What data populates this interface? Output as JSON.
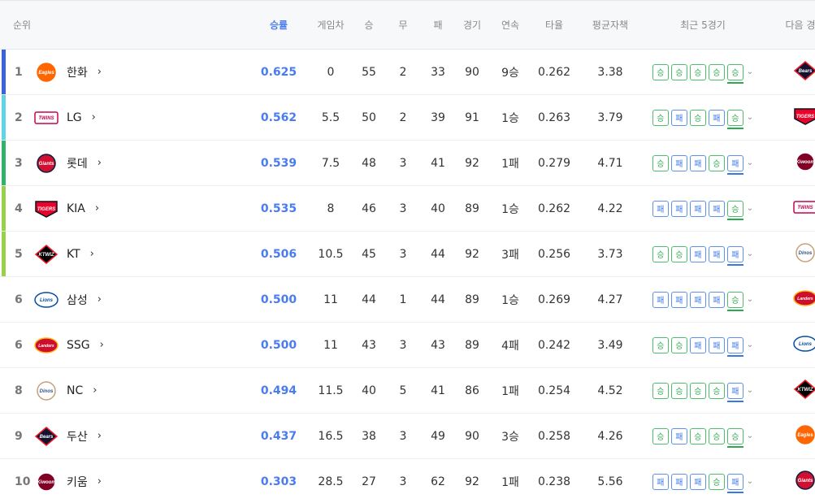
{
  "headers": {
    "rank": "순위",
    "pct": "승률",
    "gb": "게임차",
    "w": "승",
    "d": "무",
    "l": "패",
    "g": "경기",
    "streak": "연속",
    "avg": "타율",
    "era": "평균자책",
    "recent": "최근 5경기",
    "next": "다음 경기"
  },
  "result_labels": {
    "W": "승",
    "L": "패"
  },
  "colors": {
    "accent": "#4a7cf0",
    "win": "#2fa84f",
    "loss": "#3a78e6"
  },
  "teams": [
    {
      "rank": "1",
      "name": "한화",
      "logo": "eagles-logo",
      "bar": "#3b63e0",
      "pct": "0.625",
      "gb": "0",
      "w": "55",
      "d": "2",
      "l": "33",
      "g": "90",
      "streak": "9승",
      "avg": "0.262",
      "era": "3.38",
      "recent": [
        "W",
        "W",
        "W",
        "W",
        "W"
      ],
      "next": "bears-logo"
    },
    {
      "rank": "2",
      "name": "LG",
      "logo": "twins-logo",
      "bar": "#5fd4e6",
      "pct": "0.562",
      "gb": "5.5",
      "w": "50",
      "d": "2",
      "l": "39",
      "g": "91",
      "streak": "1승",
      "avg": "0.263",
      "era": "3.79",
      "recent": [
        "W",
        "L",
        "W",
        "L",
        "W"
      ],
      "next": "tigers-logo"
    },
    {
      "rank": "3",
      "name": "롯데",
      "logo": "giants-logo",
      "bar": "#31b36b",
      "pct": "0.539",
      "gb": "7.5",
      "w": "48",
      "d": "3",
      "l": "41",
      "g": "92",
      "streak": "1패",
      "avg": "0.279",
      "era": "4.71",
      "recent": [
        "W",
        "L",
        "L",
        "W",
        "L"
      ],
      "next": "heroes-logo"
    },
    {
      "rank": "4",
      "name": "KIA",
      "logo": "tigers-logo",
      "bar": "#9ad14b",
      "pct": "0.535",
      "gb": "8",
      "w": "46",
      "d": "3",
      "l": "40",
      "g": "89",
      "streak": "1승",
      "avg": "0.262",
      "era": "4.22",
      "recent": [
        "L",
        "L",
        "L",
        "L",
        "W"
      ],
      "next": "twins-logo"
    },
    {
      "rank": "5",
      "name": "KT",
      "logo": "wiz-logo",
      "bar": "#9ad14b",
      "pct": "0.506",
      "gb": "10.5",
      "w": "45",
      "d": "3",
      "l": "44",
      "g": "92",
      "streak": "3패",
      "avg": "0.256",
      "era": "3.73",
      "recent": [
        "W",
        "W",
        "L",
        "L",
        "L"
      ],
      "next": "dinos-logo"
    },
    {
      "rank": "6",
      "name": "삼성",
      "logo": "lions-logo",
      "bar": "",
      "pct": "0.500",
      "gb": "11",
      "w": "44",
      "d": "1",
      "l": "44",
      "g": "89",
      "streak": "1승",
      "avg": "0.269",
      "era": "4.27",
      "recent": [
        "L",
        "L",
        "L",
        "L",
        "W"
      ],
      "next": "landers-logo"
    },
    {
      "rank": "6",
      "name": "SSG",
      "logo": "landers-logo",
      "bar": "",
      "pct": "0.500",
      "gb": "11",
      "w": "43",
      "d": "3",
      "l": "43",
      "g": "89",
      "streak": "4패",
      "avg": "0.242",
      "era": "3.49",
      "recent": [
        "W",
        "W",
        "L",
        "L",
        "L"
      ],
      "next": "lions-logo"
    },
    {
      "rank": "8",
      "name": "NC",
      "logo": "dinos-logo",
      "bar": "",
      "pct": "0.494",
      "gb": "11.5",
      "w": "40",
      "d": "5",
      "l": "41",
      "g": "86",
      "streak": "1패",
      "avg": "0.254",
      "era": "4.52",
      "recent": [
        "W",
        "W",
        "W",
        "W",
        "L"
      ],
      "next": "wiz-logo"
    },
    {
      "rank": "9",
      "name": "두산",
      "logo": "bears-logo",
      "bar": "",
      "pct": "0.437",
      "gb": "16.5",
      "w": "38",
      "d": "3",
      "l": "49",
      "g": "90",
      "streak": "3승",
      "avg": "0.258",
      "era": "4.26",
      "recent": [
        "W",
        "L",
        "W",
        "W",
        "W"
      ],
      "next": "eagles-logo"
    },
    {
      "rank": "10",
      "name": "키움",
      "logo": "heroes-logo",
      "bar": "",
      "pct": "0.303",
      "gb": "28.5",
      "w": "27",
      "d": "3",
      "l": "62",
      "g": "92",
      "streak": "1패",
      "avg": "0.238",
      "era": "5.56",
      "recent": [
        "L",
        "L",
        "L",
        "W",
        "L"
      ],
      "next": "giants-logo"
    }
  ]
}
